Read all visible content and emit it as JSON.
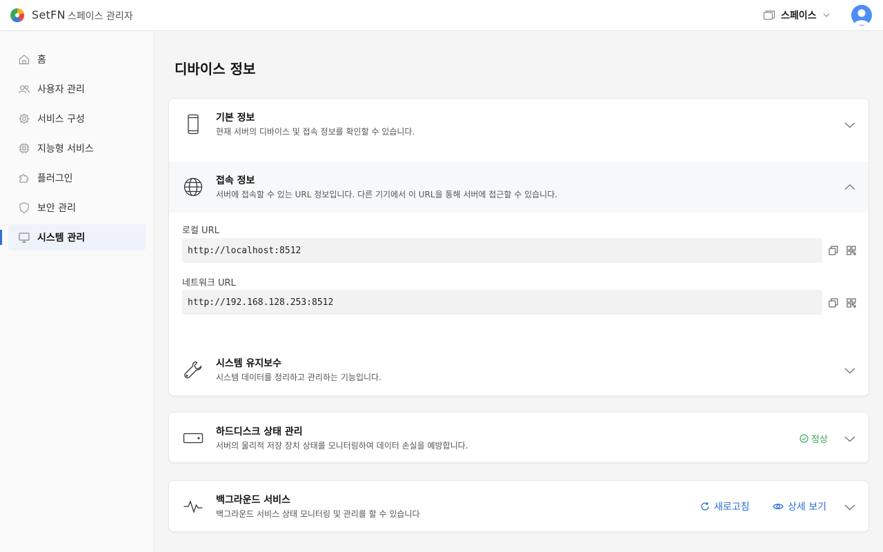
{
  "header": {
    "brand": "SetFN",
    "app_title": "스페이스 관리자",
    "space_label": "스페이스"
  },
  "sidebar": {
    "items": [
      {
        "label": "홈",
        "icon": "home-icon"
      },
      {
        "label": "사용자 관리",
        "icon": "users-icon"
      },
      {
        "label": "서비스 구성",
        "icon": "gear-icon"
      },
      {
        "label": "지능형 서비스",
        "icon": "chip-icon"
      },
      {
        "label": "플러그인",
        "icon": "puzzle-icon"
      },
      {
        "label": "보안 관리",
        "icon": "shield-icon"
      },
      {
        "label": "시스템 관리",
        "icon": "monitor-icon",
        "active": true
      }
    ]
  },
  "page": {
    "title": "디바이스 정보"
  },
  "device_card": {
    "basic": {
      "title": "기본 정보",
      "desc": "현재 서버의 디바이스 및 접속 정보를 확인할 수 있습니다."
    },
    "access": {
      "title": "접속 정보",
      "desc": "서버에 접속할 수 있는 URL 정보입니다. 다른 기기에서 이 URL을 통해 서버에 접근할 수 있습니다.",
      "local_label": "로컬 URL",
      "local_url": "http://localhost:8512",
      "network_label": "네트워크 URL",
      "network_url": "http://192.168.128.253:8512"
    },
    "maintenance": {
      "title": "시스템 유지보수",
      "desc": "시스템 데이터를 정리하고 관리하는 기능입니다."
    }
  },
  "disk_card": {
    "title": "하드디스크 상태 관리",
    "desc": "서버의 물리적 저장 장치 상태를 모니터링하여 데이터 손실을 예방합니다.",
    "status": "정상"
  },
  "bg_card": {
    "title": "백그라운드 서비스",
    "desc": "백그라운드 서비스 상태 모니터링 및 관리를 할 수 있습니다",
    "refresh_label": "새로고침",
    "detail_label": "상세 보기"
  },
  "colors": {
    "accent": "#2f6fdb",
    "ok": "#3aa757"
  }
}
